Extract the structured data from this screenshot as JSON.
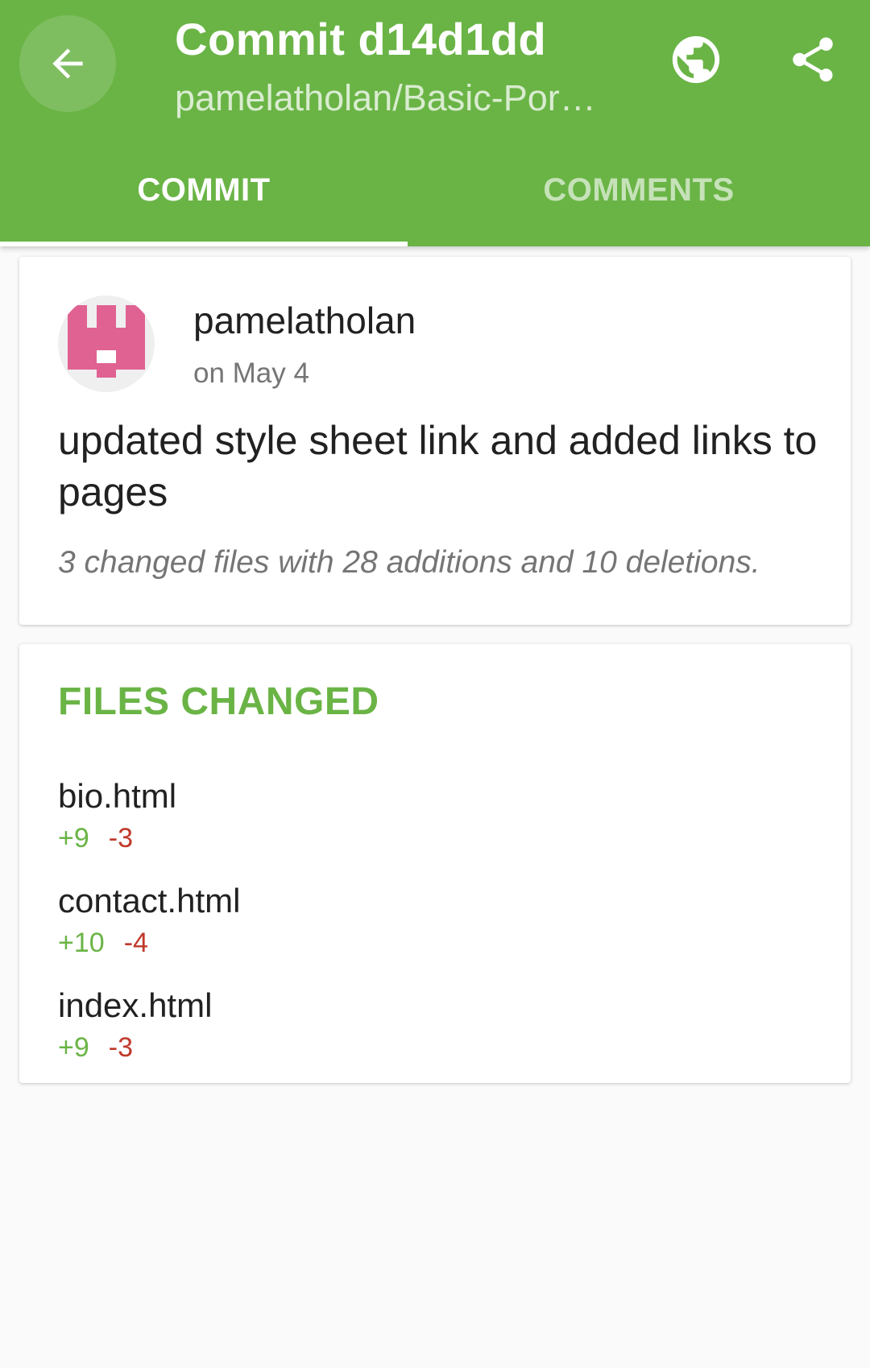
{
  "appbar": {
    "title": "Commit d14d1dd",
    "subtitle": "pamelatholan/Basic-Por…",
    "accent_color": "#6ab446",
    "back_icon": "arrow-left-icon",
    "open_in_browser_icon": "globe-icon",
    "share_icon": "share-icon"
  },
  "tabs": [
    {
      "label": "COMMIT",
      "selected": true
    },
    {
      "label": "COMMENTS",
      "selected": false
    }
  ],
  "commit": {
    "author": "pamelatholan",
    "date": "on May 4",
    "message": "updated style sheet link and added links to pages",
    "summary": "3 changed files with 28 additions and 10 deletions."
  },
  "files_changed": {
    "heading": "FILES CHANGED",
    "files": [
      {
        "name": "bio.html",
        "additions": "+9",
        "deletions": "-3"
      },
      {
        "name": "contact.html",
        "additions": "+10",
        "deletions": "-4"
      },
      {
        "name": "index.html",
        "additions": "+9",
        "deletions": "-3"
      }
    ]
  },
  "colors": {
    "additions": "#6ab446",
    "deletions": "#c0392b",
    "avatar": "#e06292"
  }
}
